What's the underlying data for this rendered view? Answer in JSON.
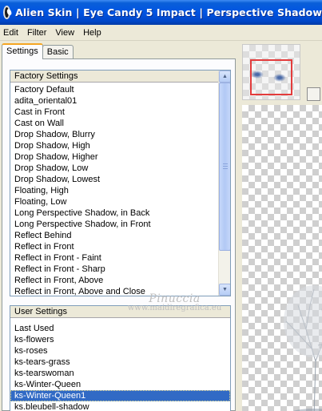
{
  "window": {
    "title": "Alien Skin | Eye Candy 5 Impact | Perspective Shadow"
  },
  "menu": [
    {
      "label": "Edit"
    },
    {
      "label": "Filter"
    },
    {
      "label": "View"
    },
    {
      "label": "Help"
    }
  ],
  "tabs": [
    {
      "label": "Settings",
      "active": true
    },
    {
      "label": "Basic",
      "active": false
    }
  ],
  "factory": {
    "header": "Factory Settings",
    "items": [
      "Factory Default",
      "adita_oriental01",
      "Cast in Front",
      "Cast on Wall",
      "Drop Shadow, Blurry",
      "Drop Shadow, High",
      "Drop Shadow, Higher",
      "Drop Shadow, Low",
      "Drop Shadow, Lowest",
      "Floating, High",
      "Floating, Low",
      "Long Perspective Shadow, in Back",
      "Long Perspective Shadow, in Front",
      "Reflect Behind",
      "Reflect in Front",
      "Reflect in Front - Faint",
      "Reflect in Front - Sharp",
      "Reflect in Front, Above",
      "Reflect in Front, Above and Close"
    ]
  },
  "user": {
    "header": "User Settings",
    "items": [
      "Last Used",
      "ks-flowers",
      "ks-roses",
      "ks-tears-grass",
      "ks-tearswoman",
      "ks-Winter-Queen",
      "ks-Winter-Queen1",
      "ks.bleubell-shadow"
    ],
    "selected": "ks-Winter-Queen1"
  },
  "watermark": {
    "line1": "Pinuccia",
    "line2": "www.maidiregrafica.eu"
  },
  "colors": {
    "title_bar": "#0054e3",
    "selection": "#316ac5",
    "nav_box": "#e33c3c"
  }
}
